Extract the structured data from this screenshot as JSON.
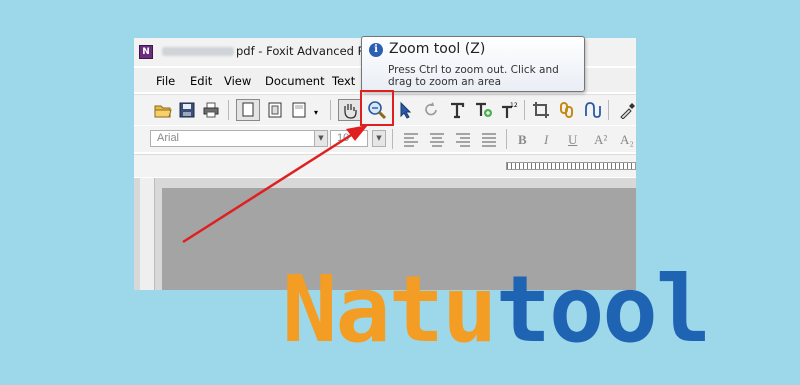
{
  "window": {
    "title": "pdf - Foxit Advanced PI",
    "app_icon": "foxit-app-icon"
  },
  "menubar": {
    "items": [
      "File",
      "Edit",
      "View",
      "Document",
      "Text"
    ]
  },
  "toolbar": {
    "icons": [
      "open-folder-icon",
      "save-icon",
      "print-icon",
      "page-view-icon",
      "page-view-2-icon",
      "page-view-3-icon",
      "hand-tool-icon",
      "zoom-tool-icon",
      "select-arrow-icon",
      "undo-icon",
      "text-tool-icon",
      "text-add-icon",
      "text-format-icon",
      "crop-icon",
      "link-icon",
      "curve-icon",
      "eyedropper-icon"
    ]
  },
  "format_bar": {
    "font_value": "Arial",
    "size_value": "10",
    "bold": "B",
    "italic": "I",
    "underline": "U",
    "superscript": "A²",
    "subscript": "A₂"
  },
  "tooltip": {
    "title": "Zoom tool (Z)",
    "description": "Press Ctrl to zoom out. Click and drag to zoom an area"
  },
  "watermark": {
    "part1": "Natu",
    "part2": "tool",
    "color1": "#f39d25",
    "color2": "#1f63b3"
  },
  "colors": {
    "background": "#9dd8ea",
    "annotation": "#e02020"
  }
}
